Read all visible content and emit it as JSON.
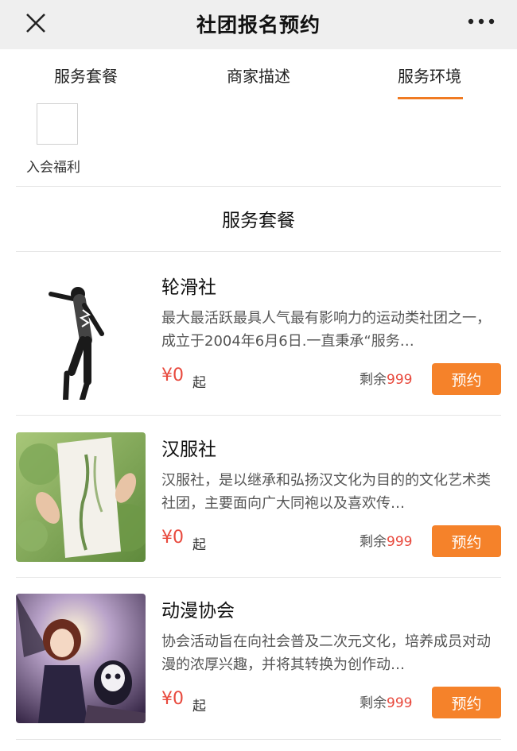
{
  "header": {
    "title": "社团报名预约",
    "close_icon": "close-icon",
    "more_icon": "more-icon"
  },
  "tabs": [
    {
      "label": "服务套餐",
      "active": false
    },
    {
      "label": "商家描述",
      "active": false
    },
    {
      "label": "服务环境",
      "active": true
    }
  ],
  "accent_color": "#f07b23",
  "price_color": "#e8493d",
  "benefit": {
    "label": "入会福利"
  },
  "section": {
    "title": "服务套餐"
  },
  "clubs": [
    {
      "name": "轮滑社",
      "description": "最大最活跃最具人气最有影响力的运动类社团之一，成立于2004年6月6日.一直秉承“服务…",
      "price": "¥0",
      "price_suffix": "起",
      "remaining_label": "剩余",
      "remaining": "999",
      "button": "预约"
    },
    {
      "name": "汉服社",
      "description": "汉服社，是以继承和弘扬汉文化为目的的文化艺术类社团，主要面向广大同袍以及喜欢传…",
      "price": "¥0",
      "price_suffix": "起",
      "remaining_label": "剩余",
      "remaining": "999",
      "button": "预约"
    },
    {
      "name": "动漫协会",
      "description": "协会活动旨在向社会普及二次元文化，培养成员对动漫的浓厚兴趣，并将其转换为创作动…",
      "price": "¥0",
      "price_suffix": "起",
      "remaining_label": "剩余",
      "remaining": "999",
      "button": "预约"
    }
  ]
}
